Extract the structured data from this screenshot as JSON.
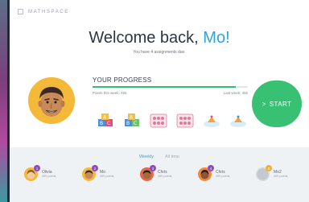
{
  "app": {
    "logo_text": "MATHSPACE"
  },
  "header": {
    "greeting": "Welcome back, ",
    "user_name": "Mo!",
    "subtitle": "You have 4 assignments due."
  },
  "progress": {
    "title": "YOUR PROGRESS",
    "points_this_week": "Points this week: 455",
    "last_week": "Last week: 455",
    "fraction": 0.92,
    "fill_color": "#2fbf71"
  },
  "badges": [
    {
      "icon": "abc-blocks-icon"
    },
    {
      "icon": "abc-blocks-icon"
    },
    {
      "icon": "dice-grid-icon"
    },
    {
      "icon": "dice-grid-icon"
    },
    {
      "icon": "cloud-cap-icon"
    },
    {
      "icon": "cloud-cap-icon"
    }
  ],
  "start": {
    "label": "START",
    "arrow": ">",
    "color": "#38c173"
  },
  "leaderboard": {
    "tabs": [
      {
        "label": "Weekly",
        "active": true
      },
      {
        "label": "All time",
        "active": false
      }
    ],
    "leaders": [
      {
        "rank": "1",
        "name": "Olivia",
        "points": "455 points",
        "color": "#f5b93a"
      },
      {
        "rank": "2",
        "name": "Mo",
        "points": "455 points",
        "color": "#f5b93a"
      },
      {
        "rank": "3",
        "name": "Chris",
        "points": "455 points",
        "color": "#e06a4a"
      },
      {
        "rank": "4",
        "name": "Chris",
        "points": "455 points",
        "color": "#f08a3a"
      },
      {
        "rank": "5",
        "name": "Mo2",
        "points": "455 points",
        "color": "#d6dadf"
      }
    ]
  },
  "accent_color": "#2aa5df"
}
